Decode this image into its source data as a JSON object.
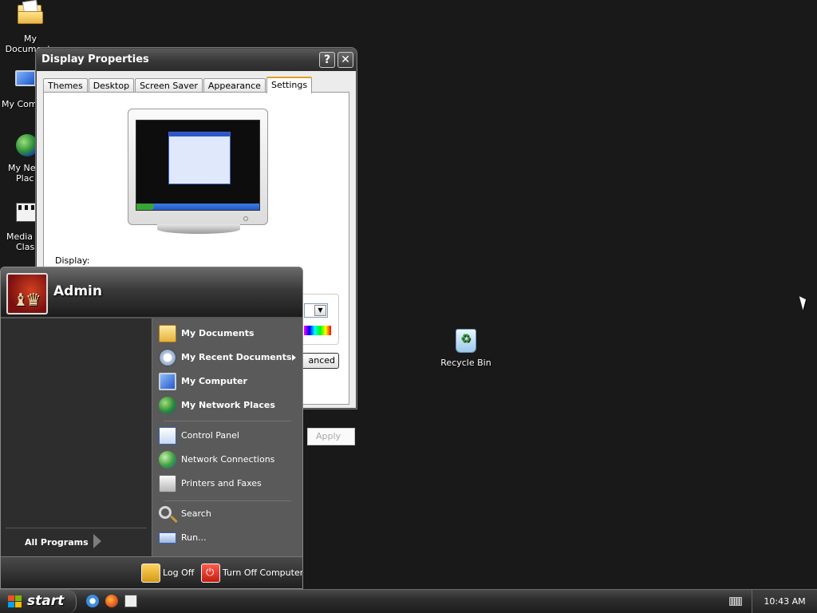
{
  "desktop": {
    "icons": [
      {
        "label": "My Documents",
        "icon": "my-documents-icon"
      },
      {
        "label": "My Com",
        "icon": "my-computer-icon"
      },
      {
        "label": "My Net",
        "label2": "Plac",
        "icon": "my-network-places-icon"
      },
      {
        "label": "Media P",
        "label2": "Class",
        "icon": "media-player-classic-icon"
      },
      {
        "label": "Recycle Bin",
        "icon": "recycle-bin-icon"
      }
    ]
  },
  "window": {
    "title": "Display Properties",
    "help_glyph": "?",
    "close_glyph": "✕",
    "tabs": [
      "Themes",
      "Desktop",
      "Screen Saver",
      "Appearance",
      "Settings"
    ],
    "active_tab": "Settings",
    "display_label": "Display:",
    "advanced_partial": "anced",
    "dropdown_glyph": "▼",
    "apply_label": "Apply"
  },
  "start_menu": {
    "username": "Admin",
    "all_programs": "All Programs",
    "right_items": [
      {
        "label": "My Documents",
        "icon": "my-documents-icon"
      },
      {
        "label": "My Recent Documents",
        "icon": "recent-documents-icon"
      },
      {
        "label": "My Computer",
        "icon": "my-computer-icon"
      },
      {
        "label": "My Network Places",
        "icon": "network-places-icon"
      },
      {
        "label": "Control Panel",
        "icon": "control-panel-icon"
      },
      {
        "label": "Network Connections",
        "icon": "network-connections-icon"
      },
      {
        "label": "Printers and Faxes",
        "icon": "printers-faxes-icon"
      },
      {
        "label": "Search",
        "icon": "search-icon"
      },
      {
        "label": "Run...",
        "icon": "run-icon"
      }
    ],
    "log_off": "Log Off",
    "turn_off": "Turn Off Computer"
  },
  "taskbar": {
    "start_label": "start",
    "clock": "10:43 AM"
  }
}
